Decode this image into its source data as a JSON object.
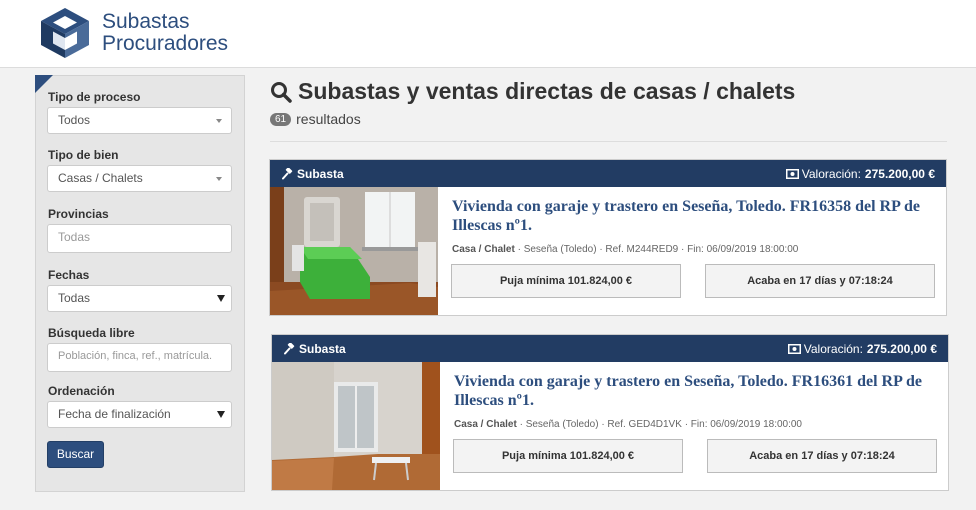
{
  "brand": {
    "line1": "Subastas",
    "line2": "Procuradores"
  },
  "filters": {
    "tipo_proceso": {
      "label": "Tipo de proceso",
      "value": "Todos"
    },
    "tipo_bien": {
      "label": "Tipo de bien",
      "value": "Casas / Chalets"
    },
    "provincias": {
      "label": "Provincias",
      "placeholder": "Todas"
    },
    "fechas": {
      "label": "Fechas",
      "value": "Todas"
    },
    "busqueda": {
      "label": "Búsqueda libre",
      "placeholder": "Población, finca, ref., matrícula."
    },
    "ordenacion": {
      "label": "Ordenación",
      "value": "Fecha de finalización"
    },
    "submit_label": "Buscar"
  },
  "main": {
    "title": "Subastas y ventas directas de casas / chalets",
    "count": "61",
    "results_label": "resultados"
  },
  "listings": [
    {
      "type": "Subasta",
      "valuation_label": "Valoración:",
      "valuation": "275.200,00 €",
      "title": "Vivienda con garaje y trastero en Seseña, Toledo. FR16358 del RP de Illescas nº1.",
      "category": "Casa / Chalet",
      "location": "Seseña (Toledo)",
      "ref": "Ref. M244RED9",
      "end": "Fin: 06/09/2019 18:00:00",
      "min_bid": "Puja mínima 101.824,00 €",
      "ends_in": "Acaba en 17 días y 07:18:24"
    },
    {
      "type": "Subasta",
      "valuation_label": "Valoración:",
      "valuation": "275.200,00 €",
      "title": "Vivienda con garaje y trastero en Seseña, Toledo. FR16361 del RP de Illescas nº1.",
      "category": "Casa / Chalet",
      "location": "Seseña (Toledo)",
      "ref": "Ref. GED4D1VK",
      "end": "Fin: 06/09/2019 18:00:00",
      "min_bid": "Puja mínima 101.824,00 €",
      "ends_in": "Acaba en 17 días y 07:18:24"
    }
  ],
  "colors": {
    "brand": "#2d4e7e",
    "card_header": "#223c63"
  },
  "icons": [
    "logo-icon",
    "search-icon",
    "gavel-icon",
    "banknote-icon"
  ]
}
